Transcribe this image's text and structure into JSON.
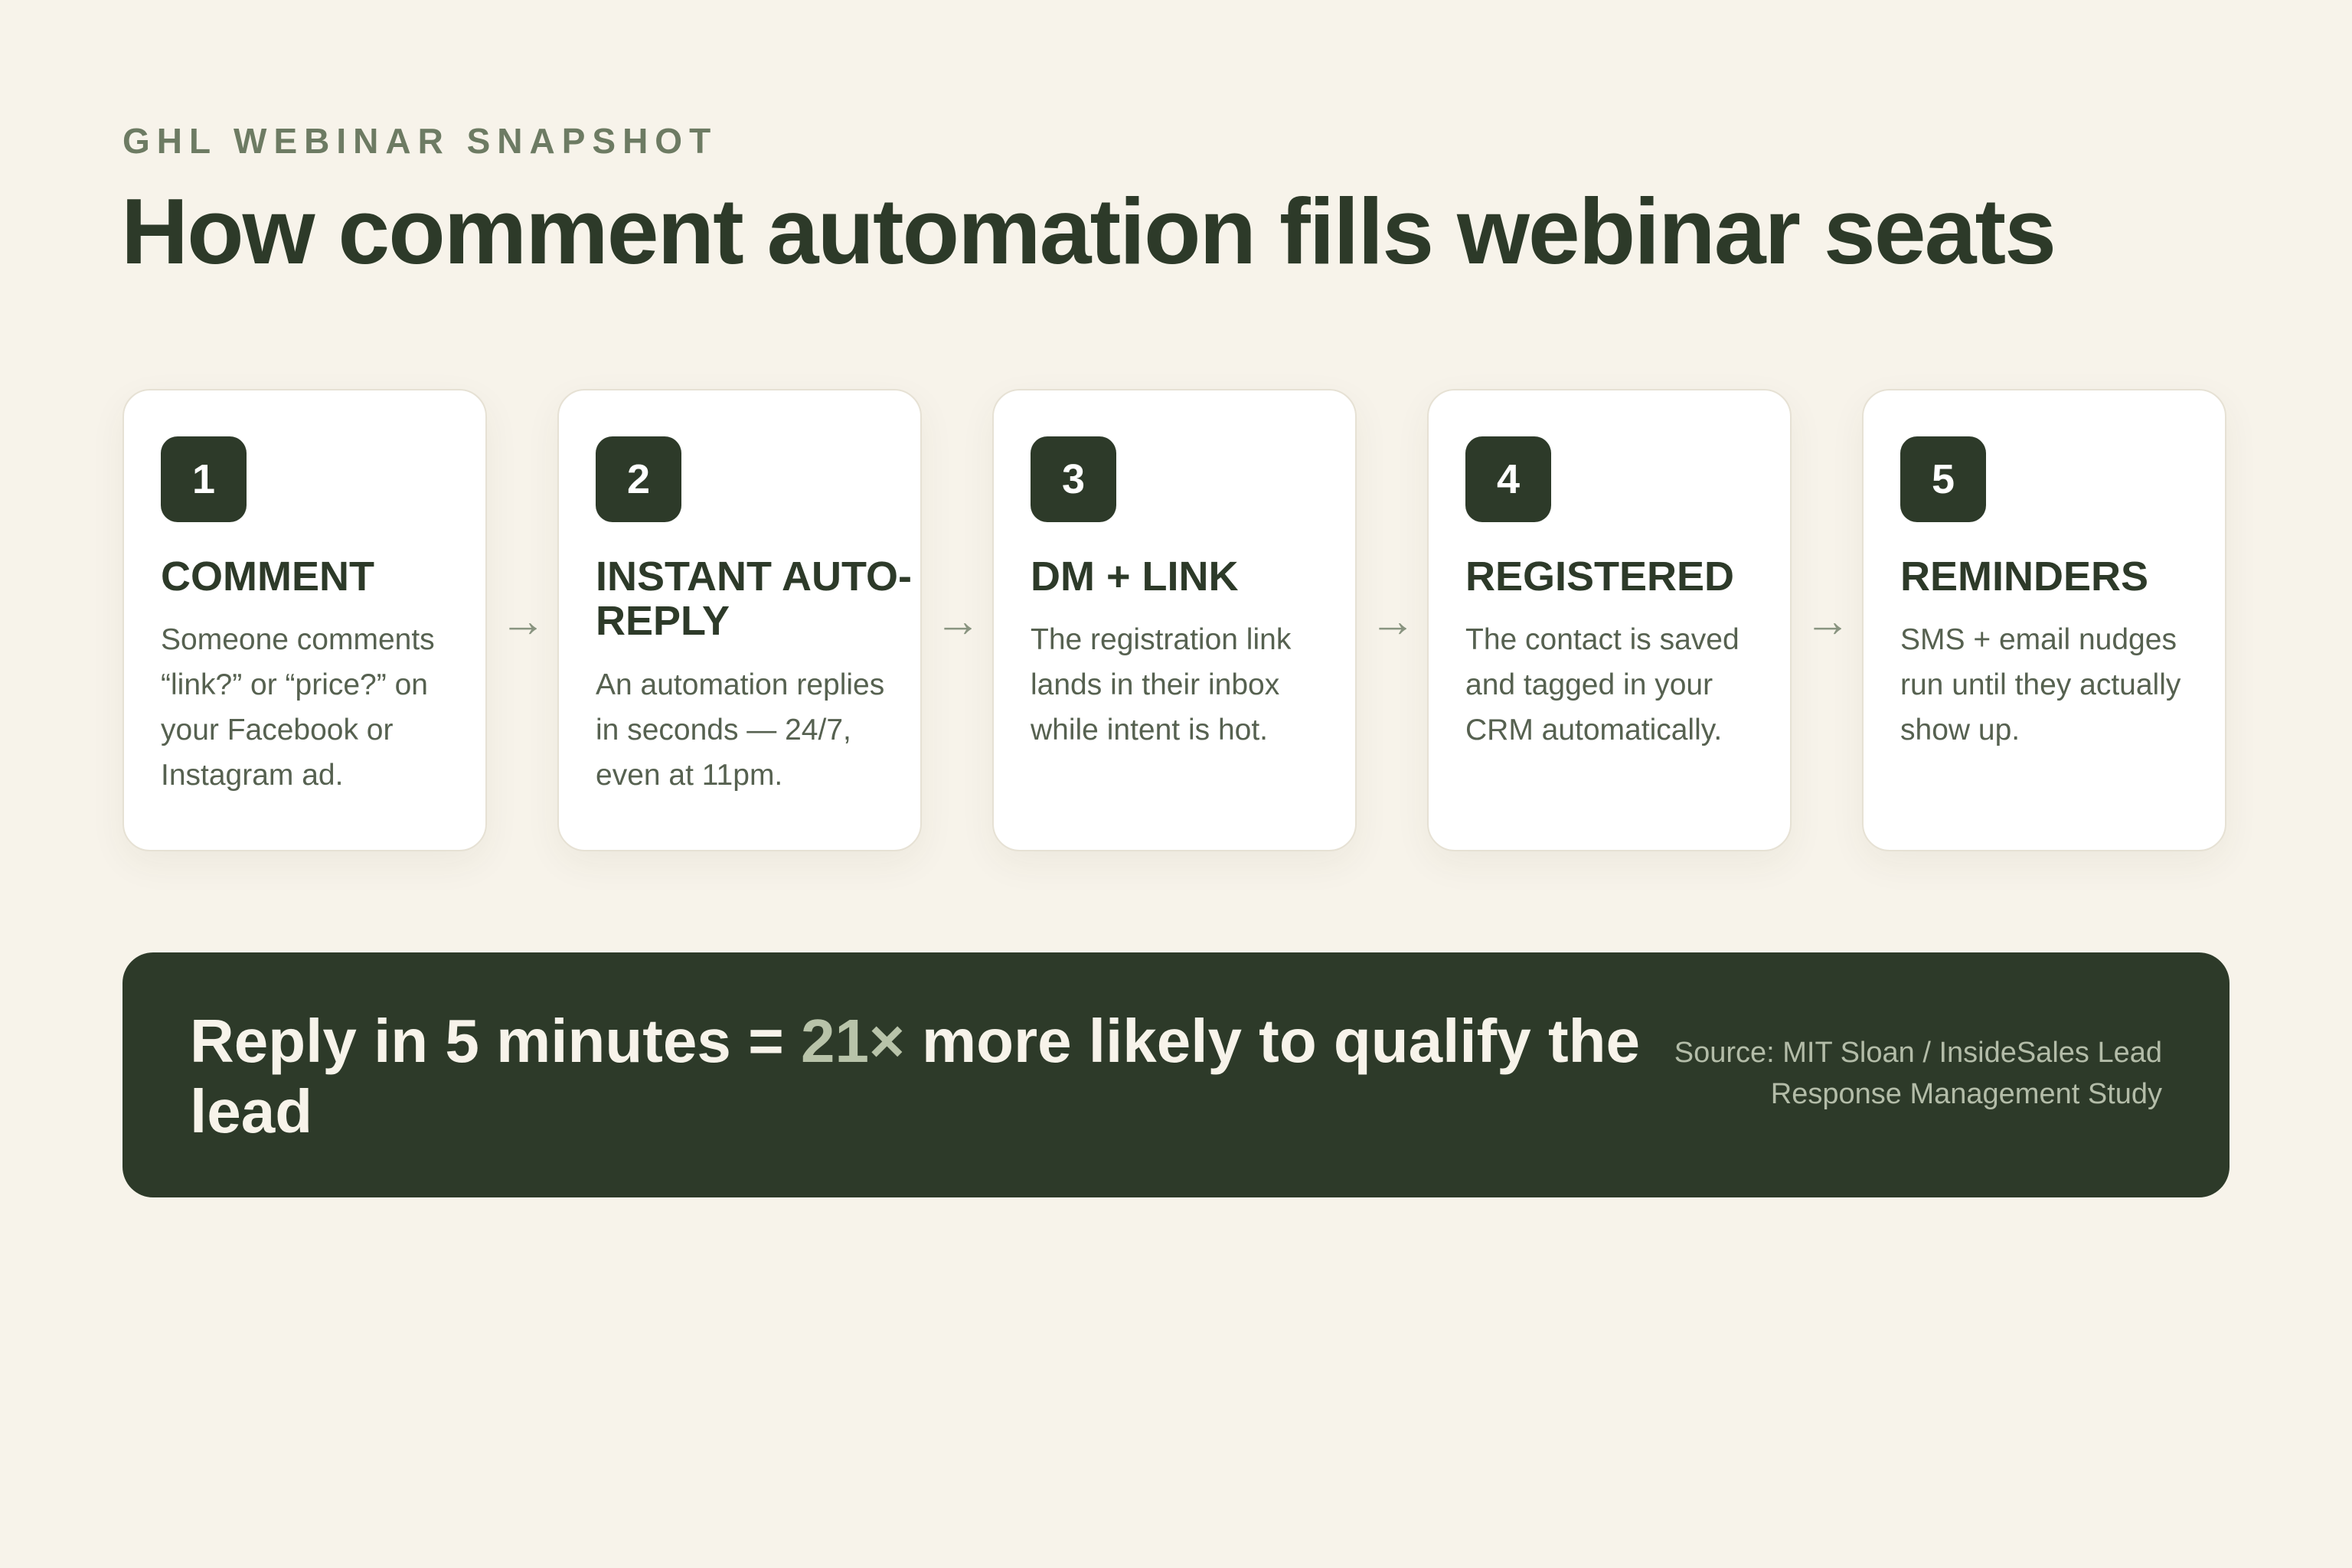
{
  "header": {
    "eyebrow": "GHL WEBINAR SNAPSHOT",
    "title": "How comment automation fills webinar seats"
  },
  "steps": [
    {
      "number": "1",
      "title": "COMMENT",
      "body": "Someone comments “link?” or “price?” on your Facebook or Instagram ad."
    },
    {
      "number": "2",
      "title": "INSTANT AUTO-REPLY",
      "body": "An automation replies in seconds — 24/7, even at 11pm."
    },
    {
      "number": "3",
      "title": "DM + LINK",
      "body": "The registration link lands in their inbox while intent is hot."
    },
    {
      "number": "4",
      "title": "REGISTERED",
      "body": "The contact is saved and tagged in your CRM automatically."
    },
    {
      "number": "5",
      "title": "REMINDERS",
      "body": "SMS + email nudges run until they actually show up."
    }
  ],
  "arrow_glyph": "→",
  "banner": {
    "headline_before": "Reply in 5 minutes = ",
    "headline_accent": "21×",
    "headline_after": " more likely to qualify the lead",
    "source": "Source: MIT Sloan / InsideSales Lead Response Management Study"
  },
  "colors": {
    "background": "#f7f3ea",
    "primary_dark": "#2d3a29",
    "accent": "#b8c3a9",
    "muted_text": "#566150"
  }
}
